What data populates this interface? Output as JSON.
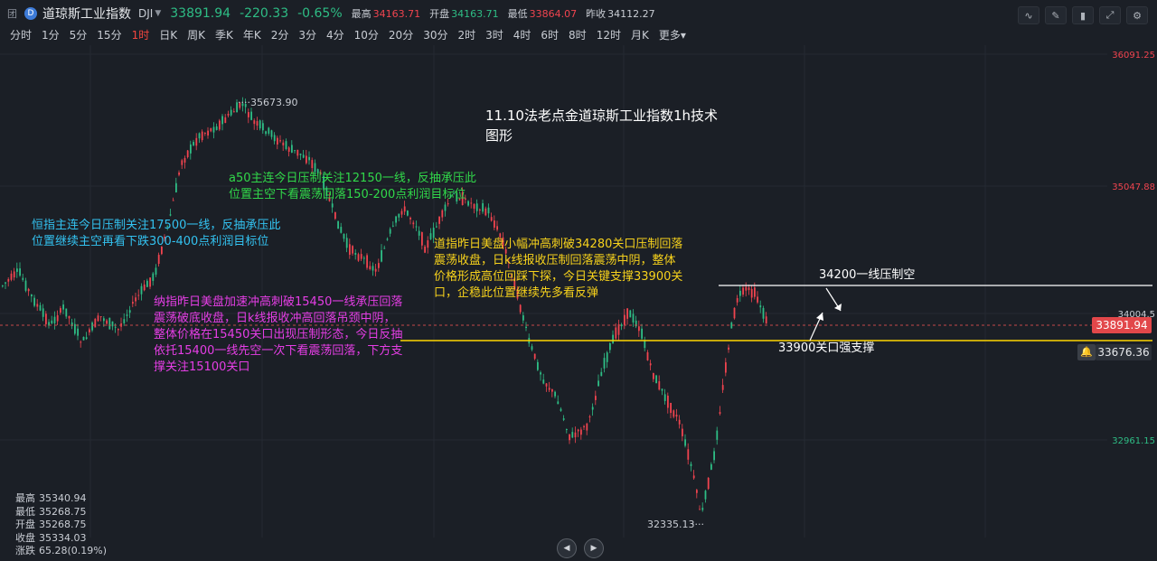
{
  "header": {
    "glyph": "团",
    "logo": "D",
    "name": "道琼斯工业指数",
    "symbol": "DJI",
    "price": "33891.94",
    "change": "-220.33",
    "pct": "-0.65%",
    "high_label": "最高",
    "high": "34163.71",
    "open_label": "开盘",
    "open": "34163.71",
    "low_label": "最低",
    "low": "33864.07",
    "prev_label": "昨收",
    "prev": "34112.27"
  },
  "periods": [
    "分时",
    "1分",
    "5分",
    "15分",
    "1时",
    "日K",
    "周K",
    "季K",
    "年K",
    "2分",
    "3分",
    "4分",
    "10分",
    "20分",
    "30分",
    "2时",
    "3时",
    "4时",
    "6时",
    "8时",
    "12时",
    "月K",
    "更多▾"
  ],
  "active_period": "1时",
  "tools": [
    {
      "icon": "indicator-icon",
      "glyph": "∿"
    },
    {
      "icon": "draw-icon",
      "glyph": "✎"
    },
    {
      "icon": "candle-icon",
      "glyph": "▮"
    },
    {
      "icon": "expand-icon",
      "glyph": "⤢"
    },
    {
      "icon": "settings-icon",
      "glyph": "⚙"
    }
  ],
  "price_axis": [
    "36091.25",
    "35047.88",
    "34004.5",
    "32961.15"
  ],
  "chart": {
    "high_mark": "35673.90",
    "low_mark": "32335.13"
  },
  "annotations": {
    "title": [
      "11.10法老点金道琼斯工业指数1h技术",
      "图形"
    ],
    "a50": [
      "a50主连今日压制关注12150一线，反抽承压此",
      "位置主空下看震荡回落150-200点利润目标位"
    ],
    "hsi": [
      "恒指主连今日压制关注17500一线，反抽承压此",
      "位置继续主空再看下跌300-400点利润目标位"
    ],
    "dow": [
      "道指昨日美盘小幅冲高刺破34280关口压制回落",
      "震荡收盘，日k线报收压制回落震荡中阴，整体",
      "价格形成高位回踩下探，今日关键支撑33900关",
      "口，企稳此位置继续先多看反弹"
    ],
    "nasdaq": [
      "纳指昨日美盘加速冲高刺破15450一线承压回落",
      "震荡破底收盘，日k线报收冲高回落吊颈中阴，",
      "整体价格在15450关口出现压制形态，今日反抽",
      "依托15400一线先空一次下看震荡回落，下方支",
      "撑关注15100关口"
    ],
    "resistance": "34200一线压制空",
    "support": "33900关口强支撑"
  },
  "badges": {
    "current": "33891.94",
    "alert": "33676.36"
  },
  "stats": [
    {
      "label": "最高",
      "value": "35340.94"
    },
    {
      "label": "最低",
      "value": "35268.75"
    },
    {
      "label": "开盘",
      "value": "35268.75"
    },
    {
      "label": "收盘",
      "value": "35334.03"
    },
    {
      "label": "涨跌",
      "value": "65.28(0.19%)"
    }
  ],
  "nav": {
    "prev": "◀",
    "next": "▶"
  },
  "colors": {
    "up": "#f0444f",
    "down": "#2ebd85",
    "bg": "#1b1f26",
    "resistance": "#ffffff",
    "support": "#ffd500"
  }
}
